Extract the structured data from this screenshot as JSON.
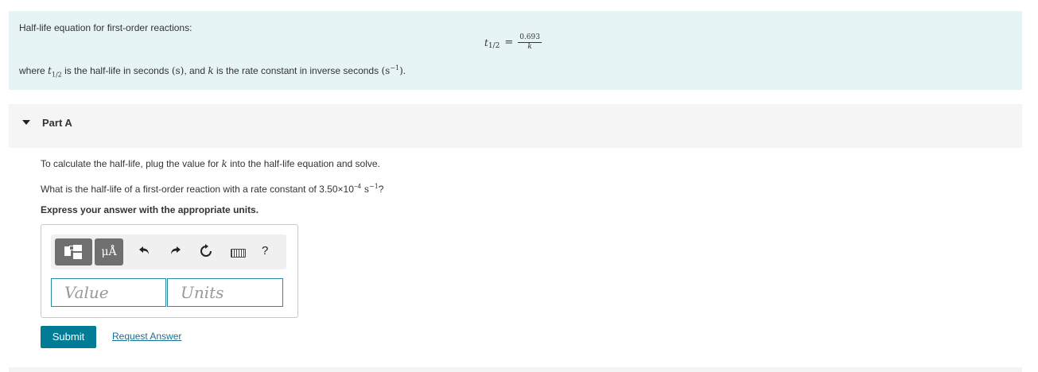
{
  "intro": {
    "title": "Half-life equation for first-order reactions:",
    "formula": {
      "lhs": "t",
      "lhs_sub": "1/2",
      "eq": "=",
      "numerator": "0.693",
      "denominator": "k"
    },
    "where": {
      "p1": "where ",
      "t": "t",
      "t_sub": "1/2",
      "p2": " is the half-life in seconds ",
      "s_unit": "(s)",
      "p3": ", and ",
      "k": "k",
      "p4": " is the rate constant in inverse seconds ",
      "inv_open": "(s",
      "inv_sup": "−1",
      "inv_close": ")",
      "p5": "."
    }
  },
  "part": {
    "title": "Part A"
  },
  "question": {
    "line1_a": "To calculate the half-life, plug the value for ",
    "line1_k": "k",
    "line1_b": " into the half-life equation and solve.",
    "line2_a": "What is the half-life of a first-order reaction with a rate constant of 3.50×10",
    "line2_exp": "−4",
    "line2_unit": " s",
    "line2_unit_exp": "−1",
    "line2_end": "?",
    "line3": "Express your answer with the appropriate units."
  },
  "toolbar": {
    "units_label": "μÅ",
    "undo_icon": "undo-icon",
    "redo_icon": "redo-icon",
    "reset_icon": "reset-icon",
    "keyboard_icon": "keyboard-icon",
    "help_label": "?"
  },
  "answer": {
    "value_placeholder": "Value",
    "units_placeholder": "Units"
  },
  "actions": {
    "submit": "Submit",
    "request": "Request Answer"
  }
}
